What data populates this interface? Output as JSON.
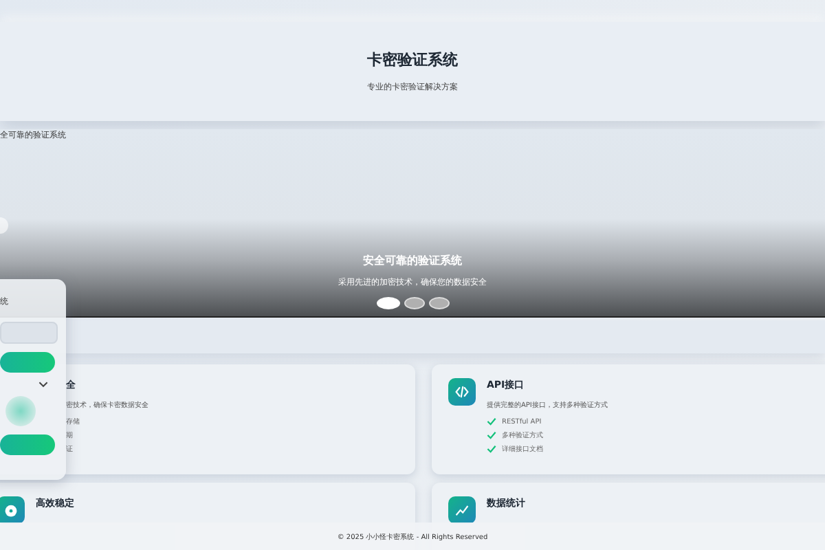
{
  "header": {
    "title": "卡密验证系统",
    "subtitle": "专业的卡密验证解决方案"
  },
  "carousel": {
    "label": "全可靠的验证系统",
    "title": "安全可靠的验证系统",
    "subtitle": "采用先进的加密技术，确保您的数据安全",
    "dots": [
      {
        "selected": true
      },
      {
        "selected": false
      },
      {
        "selected": false
      }
    ]
  },
  "side_panel": {
    "title": "统"
  },
  "features": [
    {
      "title": "全",
      "description": "密技术，确保卡密数据安全",
      "points": [
        "存储",
        "期",
        "证"
      ]
    },
    {
      "title": "API接口",
      "description": "提供完整的API接口，支持多种验证方式",
      "points": [
        "RESTful API",
        "多种验证方式",
        "详细接口文档"
      ]
    },
    {
      "title": "高效稳定"
    },
    {
      "title": "数据统计"
    }
  ],
  "footer": "© 2025 小小怪卡密系统 - All Rights Reserved"
}
